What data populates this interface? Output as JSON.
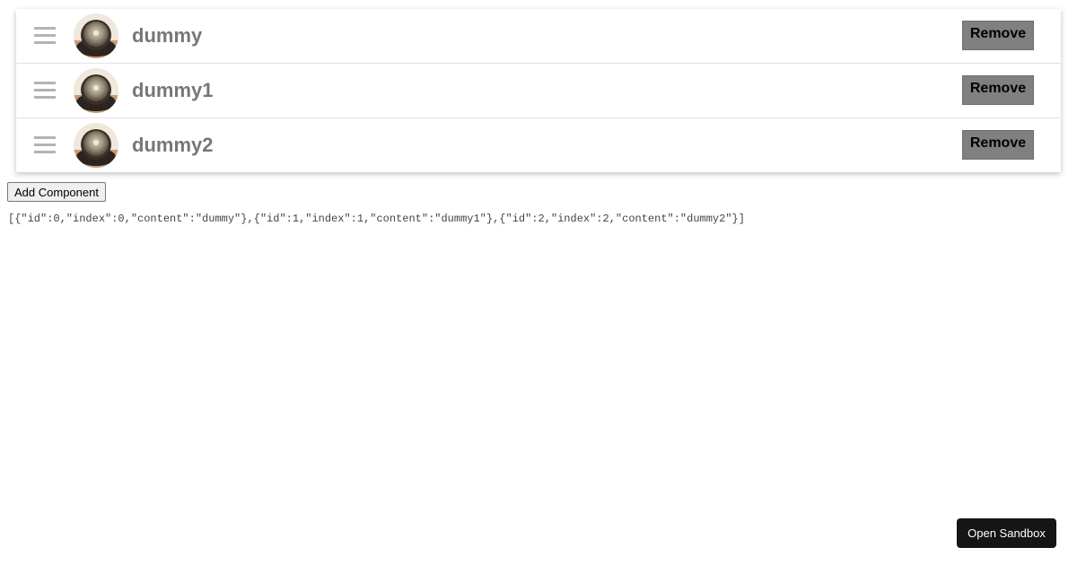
{
  "items": [
    {
      "label": "dummy",
      "remove_label": "Remove"
    },
    {
      "label": "dummy1",
      "remove_label": "Remove"
    },
    {
      "label": "dummy2",
      "remove_label": "Remove"
    }
  ],
  "add_button_label": "Add Component",
  "state_json": "[{\"id\":0,\"index\":0,\"content\":\"dummy\"},{\"id\":1,\"index\":1,\"content\":\"dummy1\"},{\"id\":2,\"index\":2,\"content\":\"dummy2\"}]",
  "open_sandbox_label": "Open Sandbox",
  "icons": {
    "drag_handle": "drag-handle-icon",
    "avatar": "avatar-image"
  },
  "colors": {
    "remove_button_bg": "#808080",
    "item_label": "#777777",
    "drag_handle": "#b3b3b3",
    "sandbox_button_bg": "#151515"
  }
}
